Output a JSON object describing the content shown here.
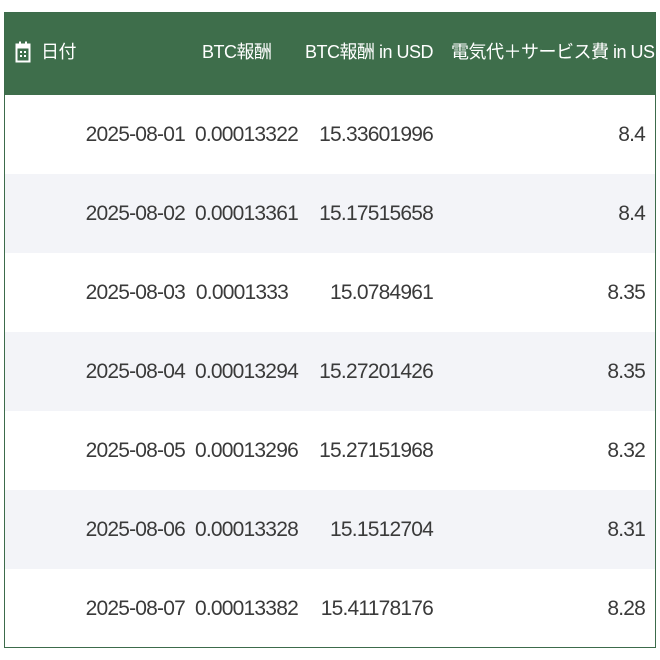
{
  "table": {
    "columns": [
      "日付",
      "BTC報酬",
      "BTC報酬 in USD",
      "電気代＋サービス費 in USD"
    ],
    "header_icon": "calendar-icon",
    "header_color": "#3e6e4b",
    "stripe_color": "#f3f4f8",
    "rows": [
      {
        "date": "2025-08-01",
        "btc": "0.00013322",
        "usd": "15.33601996",
        "cost": "8.4"
      },
      {
        "date": "2025-08-02",
        "btc": "0.00013361",
        "usd": "15.17515658",
        "cost": "8.4"
      },
      {
        "date": "2025-08-03",
        "btc": "0.0001333",
        "usd": "15.0784961",
        "cost": "8.35"
      },
      {
        "date": "2025-08-04",
        "btc": "0.00013294",
        "usd": "15.27201426",
        "cost": "8.35"
      },
      {
        "date": "2025-08-05",
        "btc": "0.00013296",
        "usd": "15.27151968",
        "cost": "8.32"
      },
      {
        "date": "2025-08-06",
        "btc": "0.00013328",
        "usd": "15.1512704",
        "cost": "8.31"
      },
      {
        "date": "2025-08-07",
        "btc": "0.00013382",
        "usd": "15.41178176",
        "cost": "8.28"
      }
    ]
  }
}
